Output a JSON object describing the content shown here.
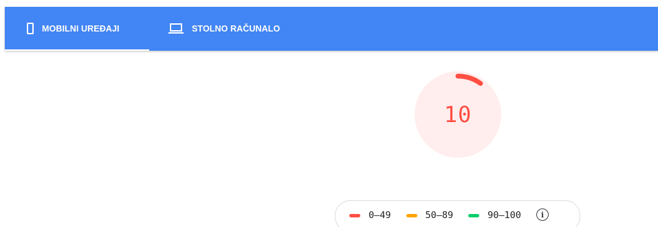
{
  "tabs": [
    {
      "label": "MOBILNI UREĐAJI",
      "icon": "phone-icon",
      "active": true
    },
    {
      "label": "STOLNO RAČUNALO",
      "icon": "laptop-icon",
      "active": false
    }
  ],
  "colors": {
    "tabbar": "#4285f4",
    "fail": "#ff4e42",
    "average": "#ffa400",
    "pass": "#0cce6b",
    "fail_bg": "#ffeeed"
  },
  "gauge": {
    "score": "10",
    "value": 10,
    "max": 100
  },
  "legend": {
    "items": [
      {
        "range": "0–49",
        "color": "#ff4e42"
      },
      {
        "range": "50–89",
        "color": "#ffa400"
      },
      {
        "range": "90–100",
        "color": "#0cce6b"
      }
    ],
    "info_icon": "info-icon",
    "info_glyph": "i"
  }
}
